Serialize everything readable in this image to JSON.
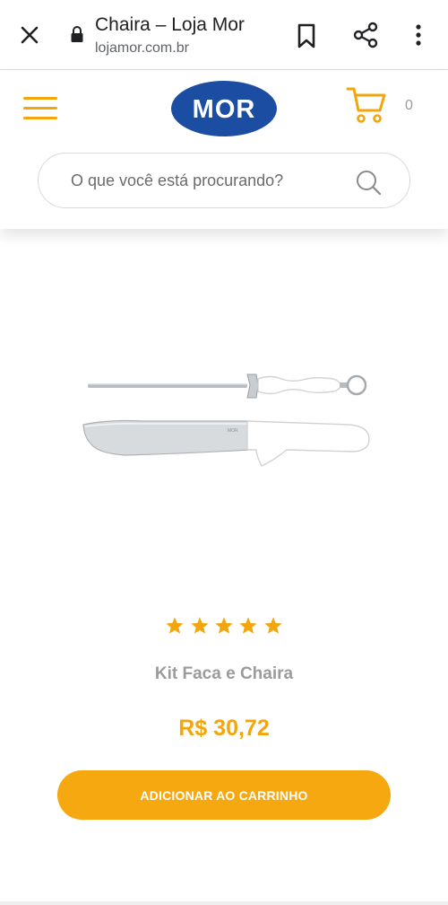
{
  "browser": {
    "page_title": "Chaira – Loja Mor",
    "url": "lojamor.com.br",
    "icons": [
      "close-icon",
      "lock-icon",
      "bookmark-icon",
      "share-icon",
      "more-vert-icon"
    ]
  },
  "header": {
    "logo_text": "MOR",
    "cart_count": "0",
    "search_placeholder": "O que você está procurando?",
    "accent_color": "#f2a60c",
    "logo_color": "#1b4ea3",
    "icons": [
      "hamburger-menu-icon",
      "cart-icon",
      "search-icon"
    ]
  },
  "product": {
    "rating_stars": 5,
    "name": "Kit Faca e Chaira",
    "price": "R$ 30,72",
    "add_to_cart_label": "ADICIONAR AO CARRINHO",
    "button_color": "#f5a80f"
  }
}
